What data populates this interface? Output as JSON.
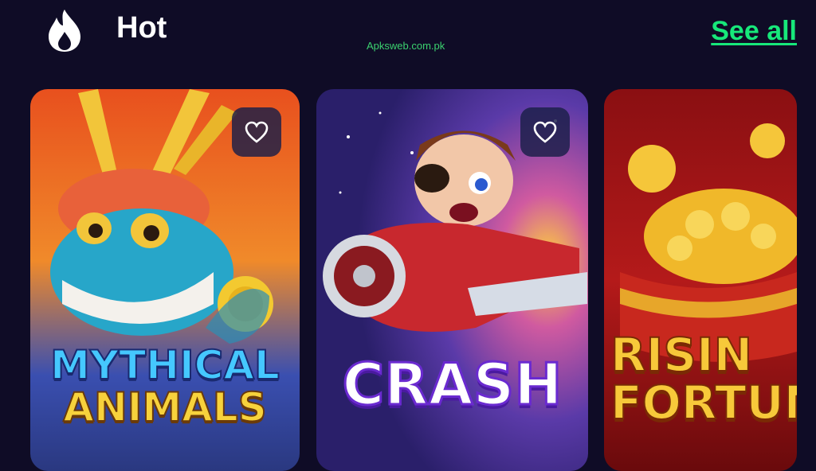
{
  "header": {
    "title": "Hot",
    "see_all_label": "See all",
    "icon": "flame-icon",
    "watermark": "Apksweb.com.pk"
  },
  "games": [
    {
      "title_line1": "MYTHICAL",
      "title_line2": "ANIMALS",
      "favorite_icon": "heart-icon"
    },
    {
      "title_line1": "CRASH",
      "title_line2": "",
      "favorite_icon": "heart-icon"
    },
    {
      "title_line1": "RISIN",
      "title_line2": "FORTUN",
      "favorite_icon": ""
    }
  ],
  "colors": {
    "background": "#0f0c26",
    "accent": "#17e87a",
    "title_text": "#ffffff"
  }
}
